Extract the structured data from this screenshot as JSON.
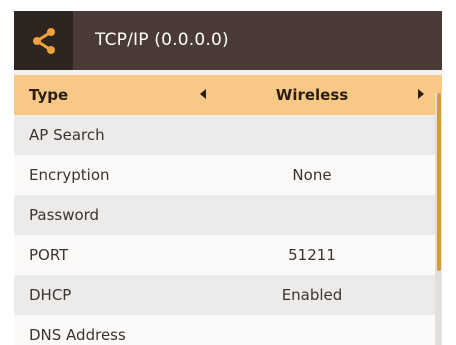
{
  "window": {
    "title": "TCP/IP (0.0.0.0)",
    "icon": "share-icon"
  },
  "settings": {
    "rows": [
      {
        "label": "Type",
        "value": "Wireless"
      },
      {
        "label": "AP Search",
        "value": ""
      },
      {
        "label": "Encryption",
        "value": "None"
      },
      {
        "label": "Password",
        "value": ""
      },
      {
        "label": "PORT",
        "value": "51211"
      },
      {
        "label": "DHCP",
        "value": "Enabled"
      },
      {
        "label": "DNS Address",
        "value": ""
      }
    ]
  },
  "colors": {
    "titlebar": "#4a3b36",
    "icon_box": "#2e2420",
    "icon_accent": "#f0a23c",
    "selected_row": "#f7c886",
    "scroll_thumb": "#d99a3a"
  }
}
